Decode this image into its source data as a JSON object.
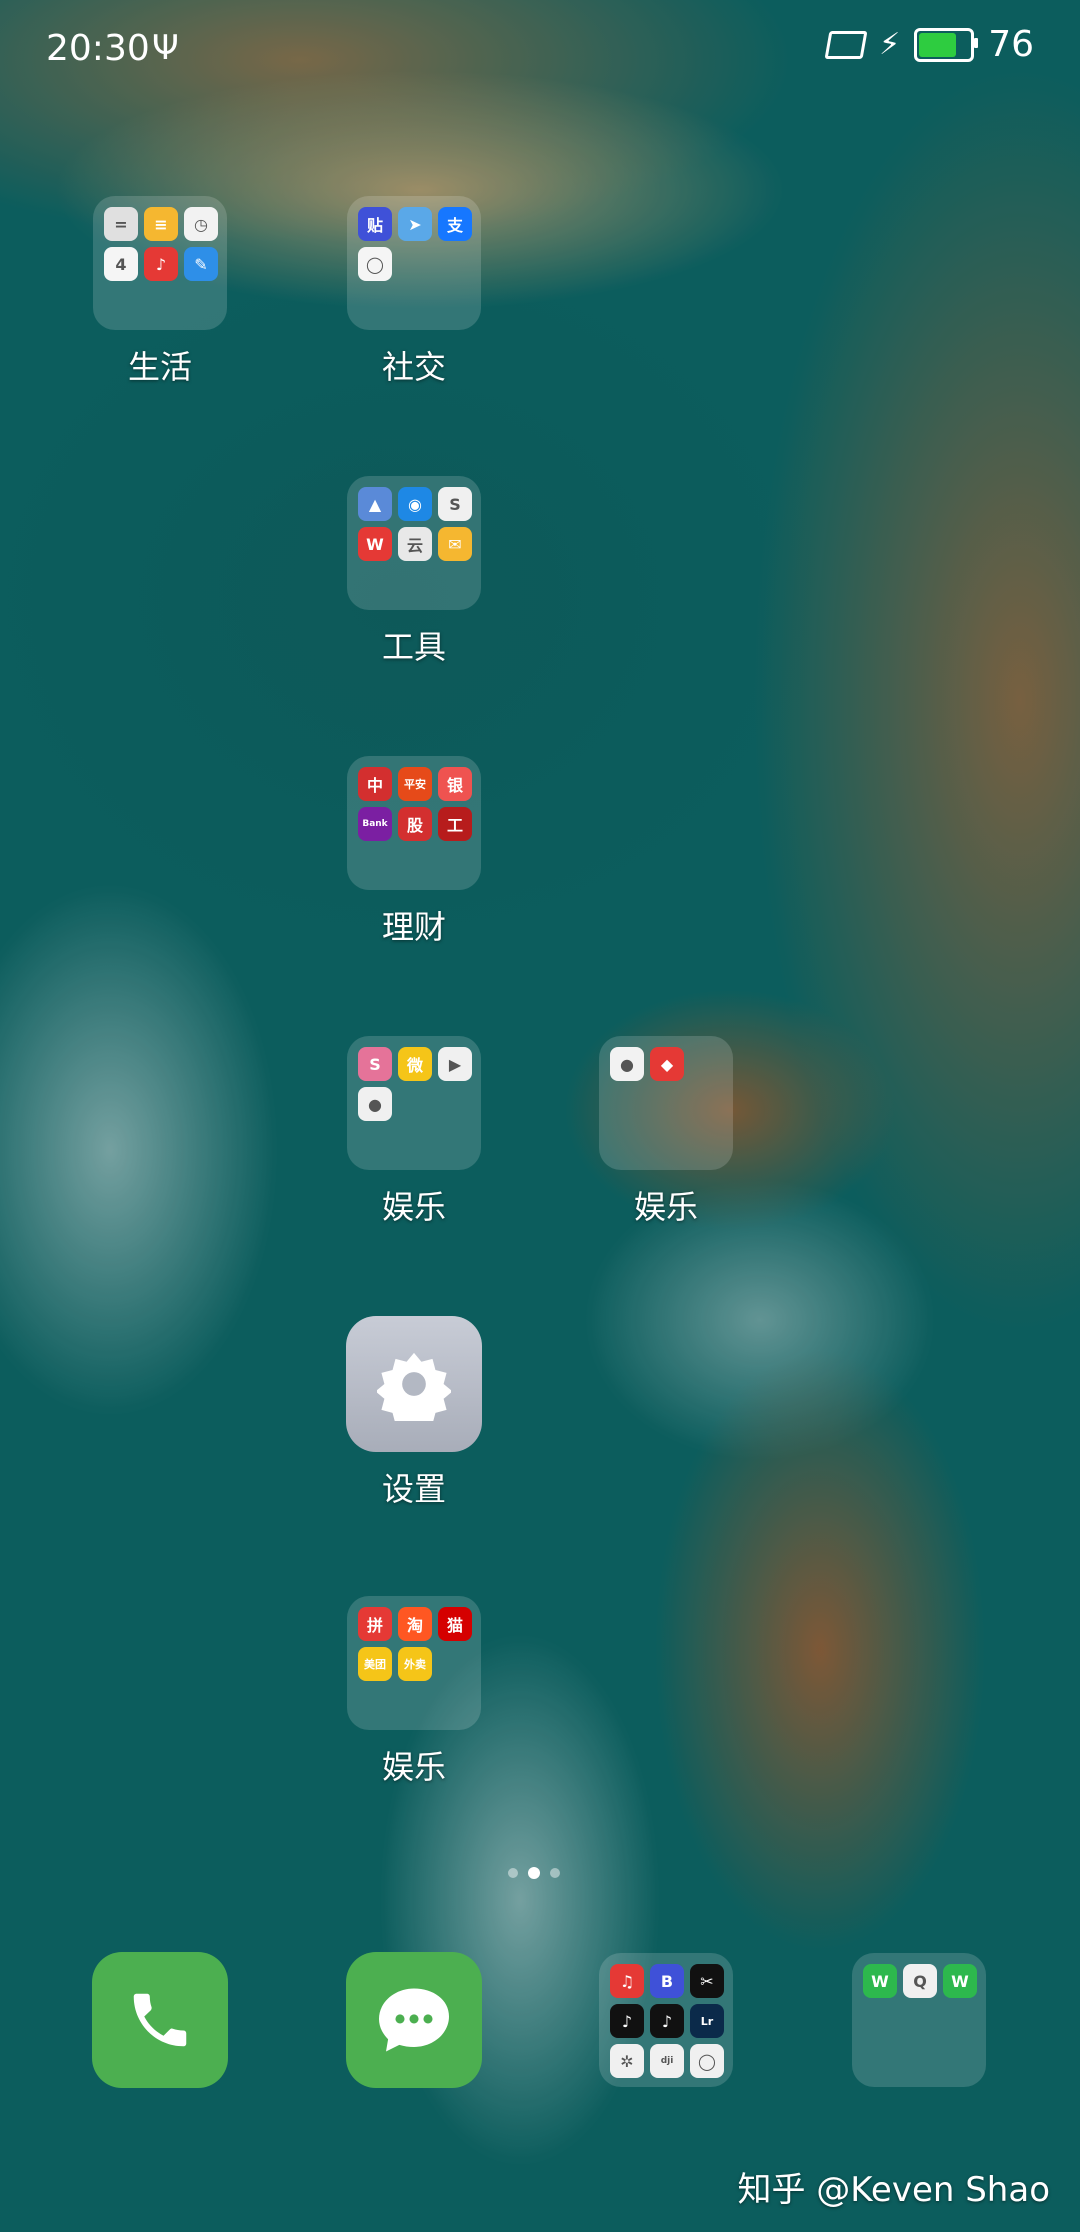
{
  "status_bar": {
    "time": "20:30",
    "usb_symbol": "Ψ",
    "charging_symbol": "⚡",
    "battery_level": 76,
    "battery_text": "76",
    "battery_color": "#2ecc40"
  },
  "folders": [
    {
      "label": "生活",
      "apps": [
        {
          "name": "calculator-app",
          "color": "#e0e0e0",
          "text": "="
        },
        {
          "name": "notes-app",
          "color": "#f5b730",
          "text": "≡"
        },
        {
          "name": "clock-app",
          "color": "#f2f2f2",
          "text": "◷"
        },
        {
          "name": "calendar-app",
          "color": "#f5f5f5",
          "text": "4"
        },
        {
          "name": "music-app",
          "color": "#e53935",
          "text": "♪"
        },
        {
          "name": "compass-app",
          "color": "#2e8fe8",
          "text": "✎"
        }
      ]
    },
    {
      "label": "社交",
      "apps": [
        {
          "name": "tieba-app",
          "color": "#3f51d8",
          "text": "贴"
        },
        {
          "name": "telegram-app",
          "color": "#5aa8e8",
          "text": "➤"
        },
        {
          "name": "alipay-app",
          "color": "#1677ff",
          "text": "支"
        },
        {
          "name": "browser-app",
          "color": "#f5f5f5",
          "text": "◯"
        }
      ]
    },
    {
      "label": "工具",
      "apps": [
        {
          "name": "mountain-app",
          "color": "#5a8ad8",
          "text": "▲"
        },
        {
          "name": "signal-app",
          "color": "#1e88e5",
          "text": "◉"
        },
        {
          "name": "map-app",
          "color": "#f0f0f0",
          "text": "S"
        },
        {
          "name": "wps-app",
          "color": "#e53935",
          "text": "W"
        },
        {
          "name": "cloud-app",
          "color": "#e8e8e8",
          "text": "云"
        },
        {
          "name": "mail-app",
          "color": "#f5b730",
          "text": "✉"
        }
      ]
    },
    {
      "label": "理财",
      "apps": [
        {
          "name": "citic-bank-app",
          "color": "#d32f2f",
          "text": "中"
        },
        {
          "name": "pingan-app",
          "color": "#e64a19",
          "text": "平安"
        },
        {
          "name": "bank-app-1",
          "color": "#ef5350",
          "text": "银"
        },
        {
          "name": "bank-app-2",
          "color": "#7b1fa2",
          "text": "Bank"
        },
        {
          "name": "stock-app",
          "color": "#d32f2f",
          "text": "股"
        },
        {
          "name": "icbc-app",
          "color": "#b71c1c",
          "text": "工"
        }
      ]
    },
    {
      "label": "娱乐",
      "apps": [
        {
          "name": "sakura-app",
          "color": "#e57399",
          "text": "S"
        },
        {
          "name": "weibo-app",
          "color": "#f5c518",
          "text": "微"
        },
        {
          "name": "tencent-video-app",
          "color": "#f0f0f0",
          "text": "▶"
        },
        {
          "name": "taobao-live-app",
          "color": "#f0f0f0",
          "text": "●"
        }
      ]
    },
    {
      "label": "娱乐",
      "apps": [
        {
          "name": "camera-app",
          "color": "#f2f2f2",
          "text": "●"
        },
        {
          "name": "gallery-app",
          "color": "#e53935",
          "text": "◆"
        }
      ]
    },
    {
      "label": "娱乐",
      "apps": [
        {
          "name": "pinduoduo-app",
          "color": "#e53935",
          "text": "拼"
        },
        {
          "name": "taobao-app",
          "color": "#ff5722",
          "text": "淘"
        },
        {
          "name": "tmall-app",
          "color": "#d50000",
          "text": "猫"
        },
        {
          "name": "meituan-app",
          "color": "#f5c518",
          "text": "美团"
        },
        {
          "name": "waimai-app",
          "color": "#f5c518",
          "text": "外卖"
        }
      ]
    }
  ],
  "settings_app": {
    "label": "设置"
  },
  "dock": {
    "phone_label": "phone",
    "messages_label": "messages",
    "folder_a_apps": [
      {
        "name": "netease-music-app",
        "color": "#e53935",
        "text": "♫"
      },
      {
        "name": "bilibili-app",
        "color": "#3f51d8",
        "text": "B"
      },
      {
        "name": "capcut-app",
        "color": "#111111",
        "text": "✂"
      },
      {
        "name": "tiktok-app",
        "color": "#111111",
        "text": "♪"
      },
      {
        "name": "douyin-app",
        "color": "#111111",
        "text": "♪"
      },
      {
        "name": "lightroom-app",
        "color": "#0b2a4a",
        "text": "Lr"
      },
      {
        "name": "aperture-app",
        "color": "#f0f0f0",
        "text": "✲"
      },
      {
        "name": "dji-app",
        "color": "#f0f0f0",
        "text": "dji"
      },
      {
        "name": "ring-app",
        "color": "#f0f0f0",
        "text": "◯"
      }
    ],
    "folder_b_apps": [
      {
        "name": "wechat-app",
        "color": "#2db84d",
        "text": "W"
      },
      {
        "name": "qq-app",
        "color": "#f0f0f0",
        "text": "Q"
      },
      {
        "name": "wechat-work-app",
        "color": "#2db84d",
        "text": "W"
      }
    ]
  },
  "pager": {
    "pages": 3,
    "active_index": 1
  },
  "watermark": "知乎 @Keven Shao"
}
